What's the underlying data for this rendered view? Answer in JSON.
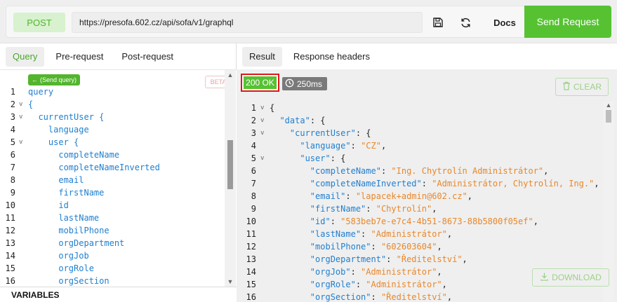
{
  "toolbar": {
    "method": "POST",
    "url": "https://presofa.602.cz/api/sofa/v1/graphql",
    "save_icon": "save-icon",
    "refresh_icon": "refresh-icon",
    "docs_label": "Docs",
    "send_label": "Send Request",
    "accent_color": "#56c232"
  },
  "left": {
    "tabs": [
      {
        "label": "Query",
        "active": true
      },
      {
        "label": "Pre-request",
        "active": false
      },
      {
        "label": "Post-request",
        "active": false
      }
    ],
    "send_query_label": "(Send query)",
    "beta_label": "BETA",
    "lines": [
      {
        "n": "1",
        "fold": "",
        "code": "query"
      },
      {
        "n": "2",
        "fold": "v",
        "code": "{"
      },
      {
        "n": "3",
        "fold": "v",
        "code": "  currentUser {"
      },
      {
        "n": "4",
        "fold": "",
        "code": "    language"
      },
      {
        "n": "5",
        "fold": "v",
        "code": "    user {"
      },
      {
        "n": "6",
        "fold": "",
        "code": "      completeName"
      },
      {
        "n": "7",
        "fold": "",
        "code": "      completeNameInverted"
      },
      {
        "n": "8",
        "fold": "",
        "code": "      email"
      },
      {
        "n": "9",
        "fold": "",
        "code": "      firstName"
      },
      {
        "n": "10",
        "fold": "",
        "code": "      id"
      },
      {
        "n": "11",
        "fold": "",
        "code": "      lastName"
      },
      {
        "n": "12",
        "fold": "",
        "code": "      mobilPhone"
      },
      {
        "n": "13",
        "fold": "",
        "code": "      orgDepartment"
      },
      {
        "n": "14",
        "fold": "",
        "code": "      orgJob"
      },
      {
        "n": "15",
        "fold": "",
        "code": "      orgRole"
      },
      {
        "n": "16",
        "fold": "",
        "code": "      orgSection"
      }
    ],
    "variables_label": "VARIABLES"
  },
  "right": {
    "tabs": [
      {
        "label": "Result",
        "active": true
      },
      {
        "label": "Response headers",
        "active": false
      }
    ],
    "status": "200 OK",
    "time": "250ms",
    "clear_label": "CLEAR",
    "download_label": "DOWNLOAD",
    "lines": [
      {
        "n": "1",
        "fold": "v",
        "indent": "",
        "key": "",
        "sep": "",
        "val": "",
        "tail": "{"
      },
      {
        "n": "2",
        "fold": "v",
        "indent": "  ",
        "key": "\"data\"",
        "sep": ": ",
        "val": "",
        "tail": "{"
      },
      {
        "n": "3",
        "fold": "v",
        "indent": "    ",
        "key": "\"currentUser\"",
        "sep": ": ",
        "val": "",
        "tail": "{"
      },
      {
        "n": "4",
        "fold": "",
        "indent": "      ",
        "key": "\"language\"",
        "sep": ": ",
        "val": "\"CZ\"",
        "tail": ","
      },
      {
        "n": "5",
        "fold": "v",
        "indent": "      ",
        "key": "\"user\"",
        "sep": ": ",
        "val": "",
        "tail": "{"
      },
      {
        "n": "6",
        "fold": "",
        "indent": "        ",
        "key": "\"completeName\"",
        "sep": ": ",
        "val": "\"Ing. Chytrolín Administrátor\"",
        "tail": ","
      },
      {
        "n": "7",
        "fold": "",
        "indent": "        ",
        "key": "\"completeNameInverted\"",
        "sep": ": ",
        "val": "\"Administrátor, Chytrolín, Ing.\"",
        "tail": ","
      },
      {
        "n": "8",
        "fold": "",
        "indent": "        ",
        "key": "\"email\"",
        "sep": ": ",
        "val": "\"lapacek+admin@602.cz\"",
        "tail": ","
      },
      {
        "n": "9",
        "fold": "",
        "indent": "        ",
        "key": "\"firstName\"",
        "sep": ": ",
        "val": "\"Chytrolín\"",
        "tail": ","
      },
      {
        "n": "10",
        "fold": "",
        "indent": "        ",
        "key": "\"id\"",
        "sep": ": ",
        "val": "\"583beb7e-e7c4-4b51-8673-88b5800f05ef\"",
        "tail": ","
      },
      {
        "n": "11",
        "fold": "",
        "indent": "        ",
        "key": "\"lastName\"",
        "sep": ": ",
        "val": "\"Administrátor\"",
        "tail": ","
      },
      {
        "n": "12",
        "fold": "",
        "indent": "        ",
        "key": "\"mobilPhone\"",
        "sep": ": ",
        "val": "\"602603604\"",
        "tail": ","
      },
      {
        "n": "13",
        "fold": "",
        "indent": "        ",
        "key": "\"orgDepartment\"",
        "sep": ": ",
        "val": "\"Ředitelství\"",
        "tail": ","
      },
      {
        "n": "14",
        "fold": "",
        "indent": "        ",
        "key": "\"orgJob\"",
        "sep": ": ",
        "val": "\"Administrátor\"",
        "tail": ","
      },
      {
        "n": "15",
        "fold": "",
        "indent": "        ",
        "key": "\"orgRole\"",
        "sep": ": ",
        "val": "\"Administrátor\"",
        "tail": ","
      },
      {
        "n": "16",
        "fold": "",
        "indent": "        ",
        "key": "\"orgSection\"",
        "sep": ": ",
        "val": "\"Ředitelství\"",
        "tail": ","
      }
    ]
  }
}
